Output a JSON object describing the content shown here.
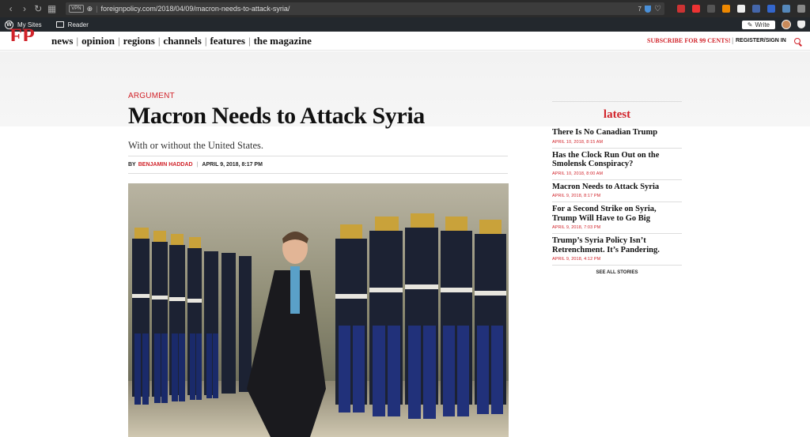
{
  "browser": {
    "vpn_label": "VPN",
    "url": "foreignpolicy.com/2018/04/09/macron-needs-to-attack-syria/",
    "badge_count": "7"
  },
  "wp_admin": {
    "my_sites": "My Sites",
    "reader": "Reader",
    "write": "Write"
  },
  "site": {
    "logo": "FP",
    "nav": [
      "news",
      "opinion",
      "regions",
      "channels",
      "features",
      "the magazine"
    ],
    "subscribe": "SUBSCRIBE FOR 99 CENTS!",
    "register": "REGISTER/SIGN IN"
  },
  "article": {
    "kicker": "ARGUMENT",
    "headline": "Macron Needs to Attack Syria",
    "dek": "With or without the United States.",
    "by": "BY",
    "author": "BENJAMIN HADDAD",
    "date": "APRIL 9, 2018, 8:17 PM"
  },
  "sidebar": {
    "title": "latest",
    "stories": [
      {
        "title": "There Is No Canadian Trump",
        "date": "APRIL 10, 2018, 8:15 AM"
      },
      {
        "title": "Has the Clock Run Out on the Smolensk Conspiracy?",
        "date": "APRIL 10, 2018, 8:00 AM"
      },
      {
        "title": "Macron Needs to Attack Syria",
        "date": "APRIL 9, 2018, 8:17 PM"
      },
      {
        "title": "For a Second Strike on Syria, Trump Will Have to Go Big",
        "date": "APRIL 9, 2018, 7:03 PM"
      },
      {
        "title": "Trump’s Syria Policy Isn’t Retrenchment. It’s Pandering.",
        "date": "APRIL 9, 2018, 4:12 PM"
      }
    ],
    "see_all": "SEE ALL STORIES"
  },
  "colors": {
    "brand_red": "#d1232a"
  }
}
